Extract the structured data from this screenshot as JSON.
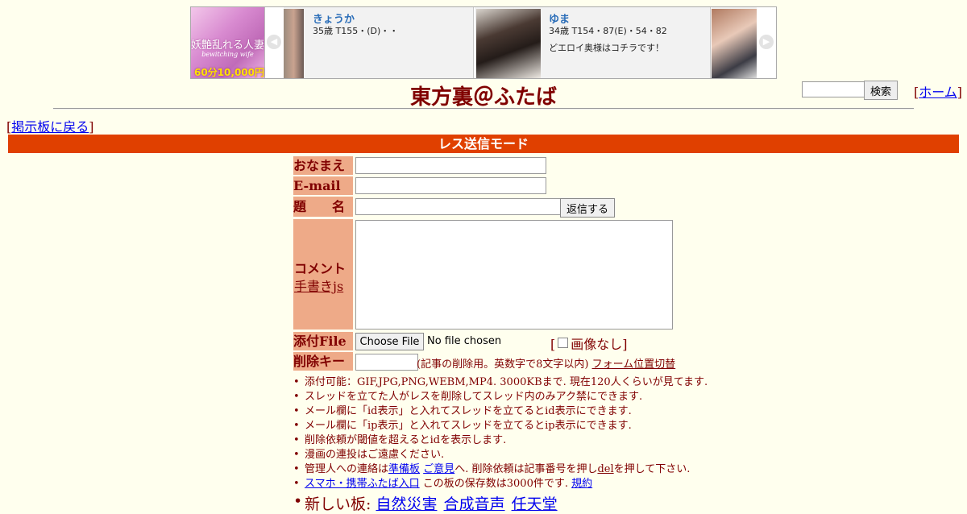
{
  "banner": {
    "ad_text": "妖艶乱れる人妻",
    "ad_sub": "bewitching wife",
    "ad_price": "60分10,000円",
    "prev_arrow": "◀",
    "next_arrow": "▶",
    "profiles": [
      {
        "name": "きょうか",
        "stats": "35歳 T155・(D)・・",
        "message": ""
      },
      {
        "name": "ゆま",
        "stats": "34歳 T154・87(E)・54・82",
        "message": "どエロイ奥様はコチラです！"
      }
    ]
  },
  "header": {
    "title": "東方裏＠ふたば",
    "search_button": "検索",
    "home_link": "ホーム",
    "back_link": "掲示板に戻る"
  },
  "mode_bar": "レス送信モード",
  "form": {
    "name_label": "おなまえ",
    "email_label": "E-mail",
    "subject_label": "題　　名",
    "reply_button": "返信する",
    "comment_label": "コメント",
    "handwriting_link": "手書きjs",
    "file_label": "添付File",
    "file_button": "Choose File",
    "file_status": "No file chosen",
    "no_image_label": "画像なし",
    "password_label": "削除キー",
    "password_note": "(記事の削除用。英数字で8文字以内)",
    "form_position_link": "フォーム位置切替"
  },
  "notes": {
    "line1": "添付可能：GIF,JPG,PNG,WEBM,MP4. 3000KBまで. 現在120人くらいが見てます.",
    "line2": "スレッドを立てた人がレスを削除してスレッド内のみアク禁にできます.",
    "line3": "メール欄に「id表示」と入れてスレッドを立てるとid表示にできます.",
    "line4": "メール欄に「ip表示」と入れてスレッドを立てるとip表示にできます.",
    "line5": "削除依頼が閾値を超えるとidを表示します.",
    "line6": "漫画の連投はご遠慮ください.",
    "line7_pre": "管理人への連絡は",
    "line7_link1": "準備板",
    "line7_link2": "ご意見",
    "line7_mid": "へ. 削除依頼は記事番号を押し",
    "line7_del": "del",
    "line7_post": "を押して下さい.",
    "line8_link": "スマホ・携帯ふたば入口",
    "line8_mid": " この板の保存数は3000件です. ",
    "line8_rules": "規約"
  },
  "new_boards": {
    "label": "新しい板:",
    "boards": [
      "自然災害",
      "合成音声",
      "任天堂"
    ]
  }
}
